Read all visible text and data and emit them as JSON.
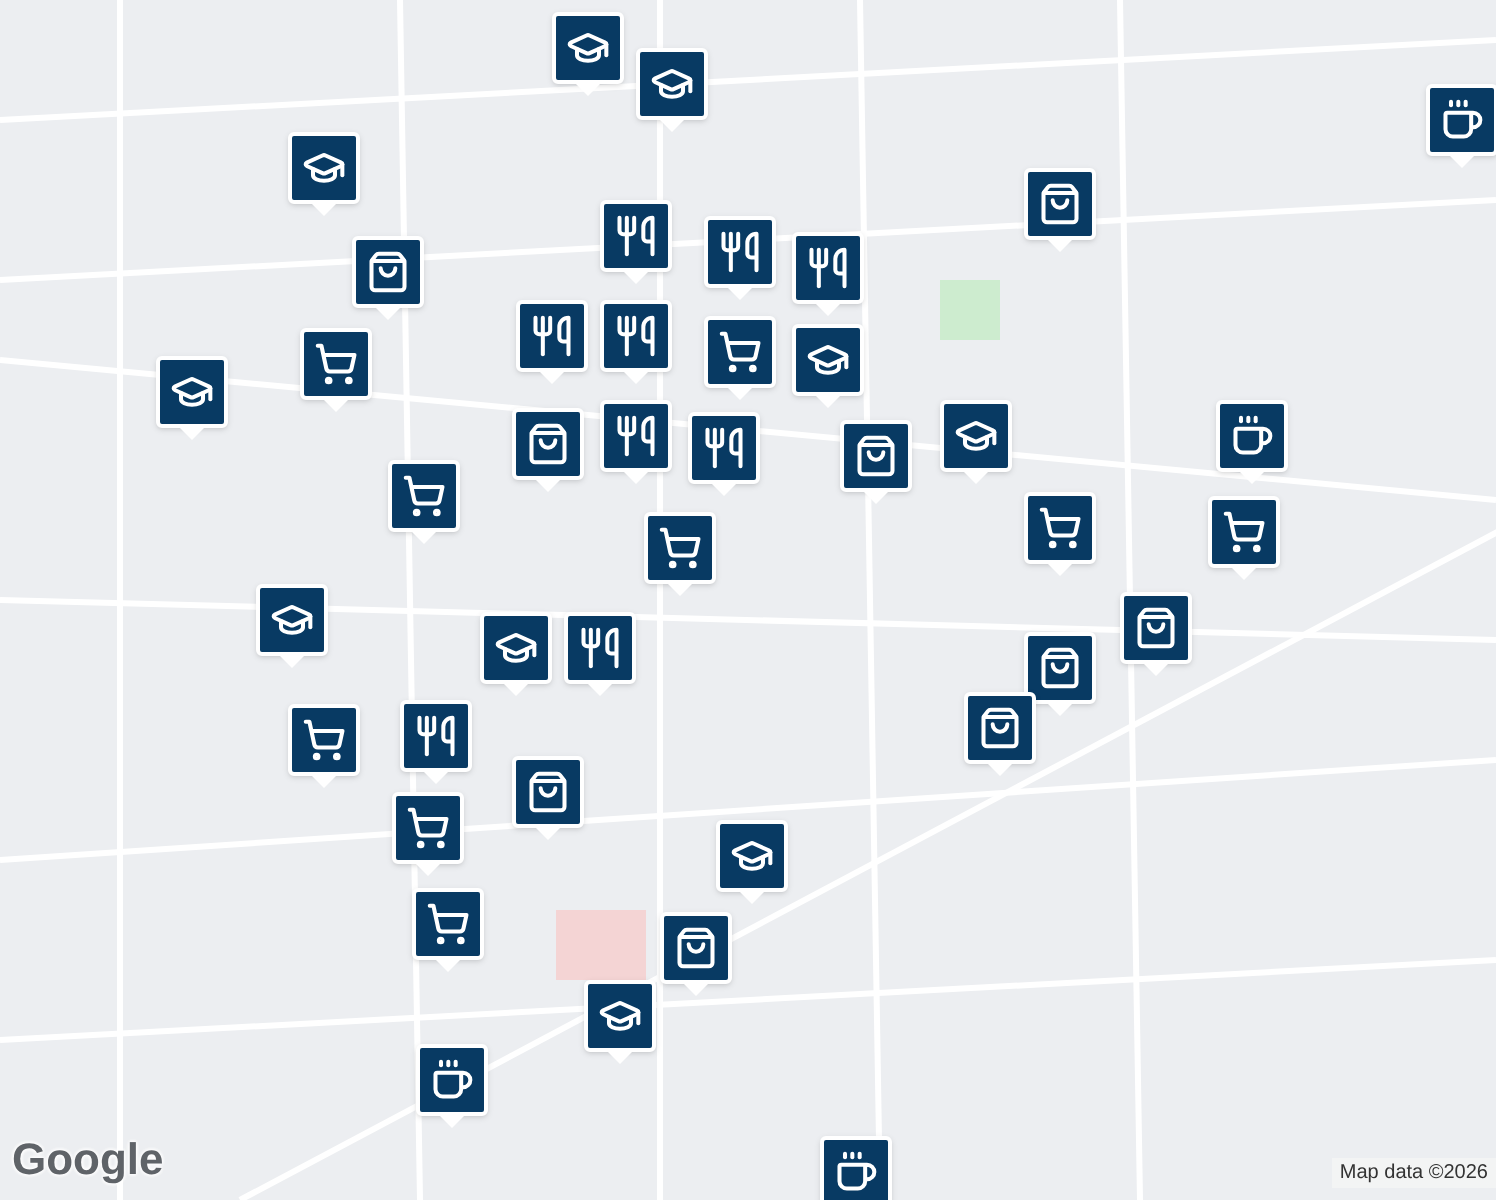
{
  "map": {
    "markers": [
      {
        "kind": "school"
      },
      {
        "kind": "school"
      },
      {
        "kind": "coffee"
      },
      {
        "kind": "school"
      },
      {
        "kind": "bag"
      },
      {
        "kind": "food"
      },
      {
        "kind": "food"
      },
      {
        "kind": "food"
      },
      {
        "kind": "bag"
      },
      {
        "kind": "cart"
      },
      {
        "kind": "food"
      },
      {
        "kind": "food"
      },
      {
        "kind": "school"
      },
      {
        "kind": "cart"
      },
      {
        "kind": "food"
      },
      {
        "kind": "food"
      },
      {
        "kind": "bag"
      },
      {
        "kind": "school"
      },
      {
        "kind": "bag"
      },
      {
        "kind": "school"
      },
      {
        "kind": "coffee"
      },
      {
        "kind": "cart"
      },
      {
        "kind": "cart"
      },
      {
        "kind": "cart"
      },
      {
        "kind": "cart"
      },
      {
        "kind": "school"
      },
      {
        "kind": "bag"
      },
      {
        "kind": "bag"
      },
      {
        "kind": "school"
      },
      {
        "kind": "food"
      },
      {
        "kind": "food"
      },
      {
        "kind": "bag"
      },
      {
        "kind": "cart"
      },
      {
        "kind": "cart"
      },
      {
        "kind": "bag"
      },
      {
        "kind": "school"
      },
      {
        "kind": "cart"
      },
      {
        "kind": "bag"
      },
      {
        "kind": "school"
      },
      {
        "kind": "coffee"
      },
      {
        "kind": "coffee"
      }
    ]
  },
  "logo": "Google",
  "attribution": "Map data ©2026"
}
